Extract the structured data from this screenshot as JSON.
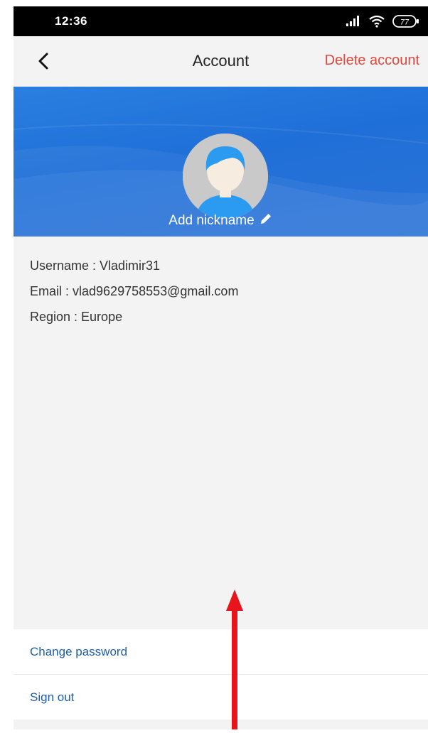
{
  "status_bar": {
    "time": "12:36",
    "battery_level": "77"
  },
  "header": {
    "title": "Account",
    "delete_label": "Delete account",
    "back_icon": "chevron-left-icon"
  },
  "profile": {
    "nickname_label": "Add nickname",
    "edit_icon": "pencil-icon",
    "avatar_icon": "avatar-icon"
  },
  "info": {
    "username": "Username : Vladimir31",
    "email": "Email : vlad9629758553@gmail.com",
    "region": "Region : Europe"
  },
  "menu": {
    "change_password": "Change password",
    "sign_out": "Sign out"
  },
  "annotation": {
    "arrow_icon": "red-arrow-up-icon"
  },
  "colors": {
    "accent_blue": "#1f6fd8",
    "link_blue": "#1f5fa8",
    "danger_red": "#e0483e",
    "arrow_red": "#e8141c",
    "background_gray": "#f3f3f3"
  }
}
